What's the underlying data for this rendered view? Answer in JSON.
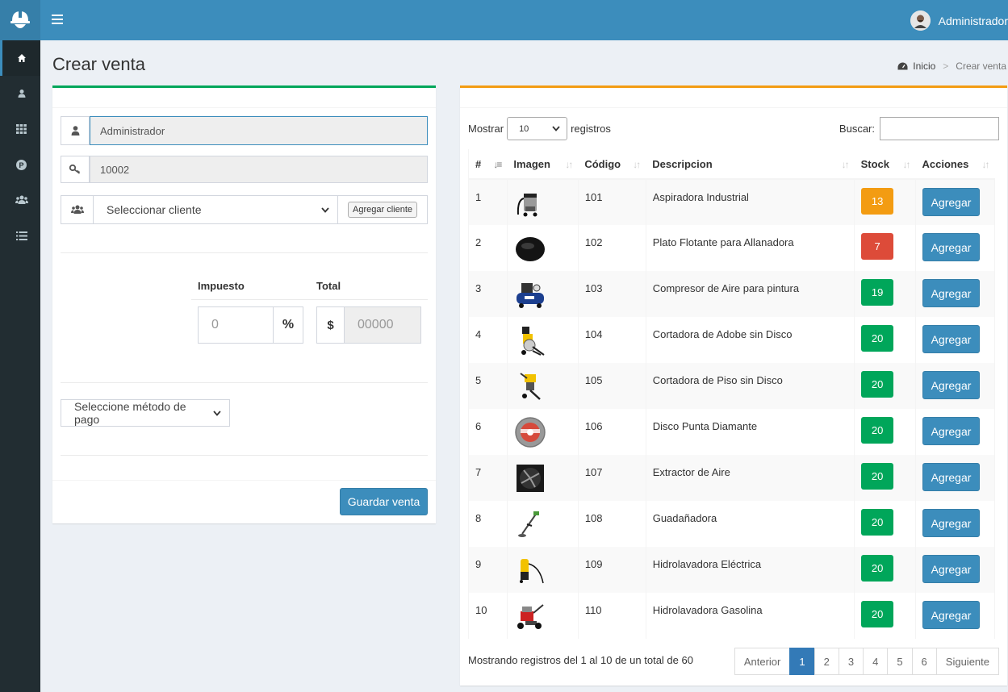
{
  "header": {
    "user_name": "Administrador"
  },
  "page": {
    "title": "Crear venta"
  },
  "breadcrumb": {
    "home": "Inicio",
    "current": "Crear venta"
  },
  "form": {
    "seller": "Administrador",
    "code": "10002",
    "client_select": "Seleccionar cliente",
    "add_client": "Agregar cliente",
    "tax_label": "Impuesto",
    "total_label": "Total",
    "tax_placeholder": "0",
    "tax_symbol": "%",
    "currency_symbol": "$",
    "total_placeholder": "00000",
    "payment_select": "Seleccione método de pago",
    "save": "Guardar venta"
  },
  "table": {
    "show_label": "Mostrar",
    "page_size": "10",
    "records_label": "registros",
    "search_label": "Buscar:",
    "headers": [
      "#",
      "Imagen",
      "Código",
      "Descripcion",
      "Stock",
      "Acciones"
    ],
    "rows": [
      {
        "n": "1",
        "code": "101",
        "desc": "Aspiradora Industrial",
        "stock": "13",
        "color": "#f39c12",
        "icon": "vacuum-cleaner-image"
      },
      {
        "n": "2",
        "code": "102",
        "desc": "Plato Flotante para Allanadora",
        "stock": "7",
        "color": "#dd4b39",
        "icon": "floating-plate-image"
      },
      {
        "n": "3",
        "code": "103",
        "desc": "Compresor de Aire para pintura",
        "stock": "19",
        "color": "#00a65a",
        "icon": "air-compressor-image"
      },
      {
        "n": "4",
        "code": "104",
        "desc": "Cortadora de Adobe sin Disco",
        "stock": "20",
        "color": "#00a65a",
        "icon": "adobe-cutter-image"
      },
      {
        "n": "5",
        "code": "105",
        "desc": "Cortadora de Piso sin Disco",
        "stock": "20",
        "color": "#00a65a",
        "icon": "floor-cutter-image"
      },
      {
        "n": "6",
        "code": "106",
        "desc": "Disco Punta Diamante",
        "stock": "20",
        "color": "#00a65a",
        "icon": "diamond-disc-image"
      },
      {
        "n": "7",
        "code": "107",
        "desc": "Extractor de Aire",
        "stock": "20",
        "color": "#00a65a",
        "icon": "air-extractor-image"
      },
      {
        "n": "8",
        "code": "108",
        "desc": "Guadañadora",
        "stock": "20",
        "color": "#00a65a",
        "icon": "brushcutter-image"
      },
      {
        "n": "9",
        "code": "109",
        "desc": "Hidrolavadora Eléctrica",
        "stock": "20",
        "color": "#00a65a",
        "icon": "electric-pressure-washer-image"
      },
      {
        "n": "10",
        "code": "110",
        "desc": "Hidrolavadora Gasolina",
        "stock": "20",
        "color": "#00a65a",
        "icon": "gas-pressure-washer-image"
      }
    ],
    "action_label": "Agregar",
    "info": "Mostrando registros del 1 al 10 de un total de 60",
    "pagination": [
      "Anterior",
      "1",
      "2",
      "3",
      "4",
      "5",
      "6",
      "Siguiente"
    ]
  }
}
